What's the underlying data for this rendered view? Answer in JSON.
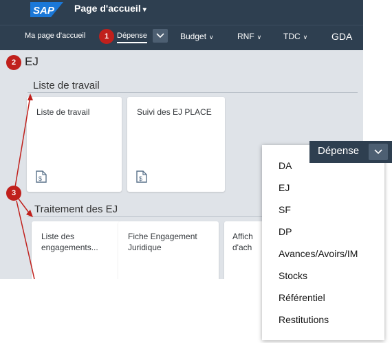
{
  "shell": {
    "logo_text": "SAP",
    "title": "Page d'accueil",
    "title_caret": "▾"
  },
  "tabs": [
    {
      "label": "Ma page d'accueil"
    },
    {
      "label": "Dépense"
    },
    {
      "label": "Budget"
    },
    {
      "label": "RNF"
    },
    {
      "label": "TDC"
    },
    {
      "label": "GDA"
    }
  ],
  "badges": [
    "1",
    "2",
    "3"
  ],
  "section": {
    "title": "EJ"
  },
  "groups": [
    {
      "title": "Liste de travail",
      "tiles": [
        "Liste de travail",
        "Suivi des EJ PLACE"
      ]
    },
    {
      "title": "Traitement des EJ",
      "tiles": [
        "Liste des engagements...",
        "Fiche Engagement Juridique",
        "Affich d'ach"
      ]
    }
  ],
  "dropdown": {
    "header": "Dépense",
    "items": [
      "DA",
      "EJ",
      "SF",
      "DP",
      "Avances/Avoirs/IM",
      "Stocks",
      "Référentiel",
      "Restitutions"
    ]
  },
  "colors": {
    "shell": "#2e3f50",
    "badge": "#c0201c",
    "annotation_line": "#c0201c",
    "background": "#dfe3e8",
    "sap_blue": "#1b78d8"
  },
  "icons": [
    "document-dollar-icon",
    "chevron-down-icon"
  ]
}
